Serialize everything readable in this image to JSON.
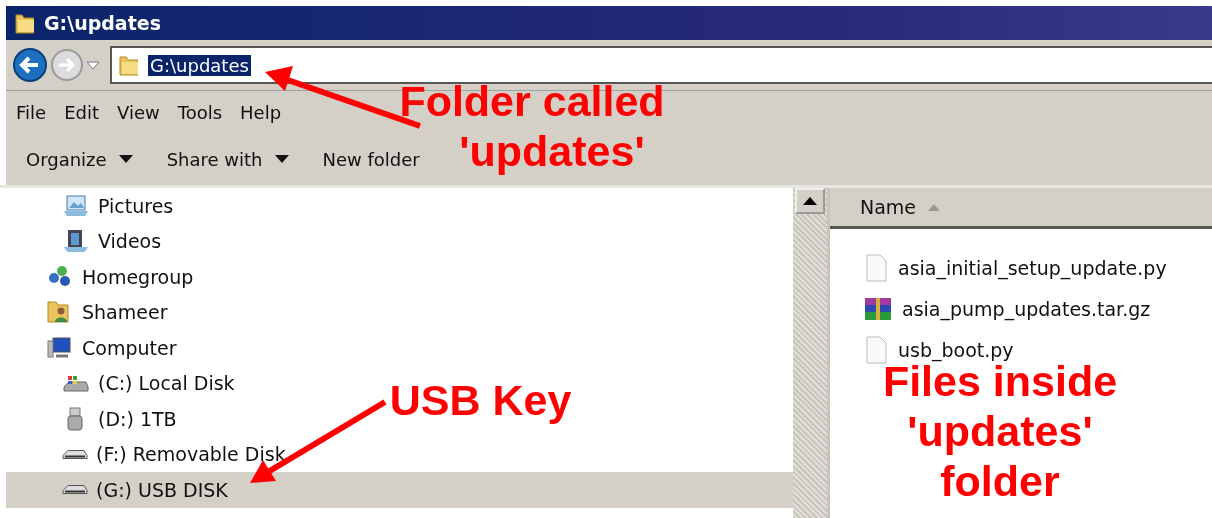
{
  "window": {
    "title": "G:\\updates"
  },
  "address_bar": {
    "path": "G:\\updates",
    "selected": true
  },
  "menu": [
    "File",
    "Edit",
    "View",
    "Tools",
    "Help"
  ],
  "toolbar": [
    {
      "label": "Organize",
      "dropdown": true
    },
    {
      "label": "Share with",
      "dropdown": true
    },
    {
      "label": "New folder",
      "dropdown": false
    }
  ],
  "tree": [
    {
      "children": [
        {
          "label": "Pictures",
          "kind": "pictures",
          "selected": false
        },
        {
          "label": "Videos",
          "kind": "videos",
          "selected": false
        }
      ]
    },
    {
      "label": "Homegroup",
      "kind": "homegroup",
      "selected": false
    },
    {
      "label": "Shameer",
      "kind": "user",
      "selected": false
    },
    {
      "label": "Computer",
      "kind": "computer",
      "selected": false,
      "children": [
        {
          "label": "(C:) Local Disk",
          "kind": "system-disk",
          "selected": false
        },
        {
          "label": "(D:) 1TB",
          "kind": "usb-drive",
          "selected": false
        },
        {
          "label": "(F:) Removable Disk",
          "kind": "removable",
          "selected": false
        },
        {
          "label": "(G:) USB DISK",
          "kind": "removable",
          "selected": true
        }
      ]
    }
  ],
  "file_list": {
    "columns": [
      {
        "label": "Name",
        "sorted_ascending": true
      }
    ],
    "files": [
      {
        "name": "asia_initial_setup_update.py",
        "kind": "document"
      },
      {
        "name": "asia_pump_updates.tar.gz",
        "kind": "archive"
      },
      {
        "name": "usb_boot.py",
        "kind": "document"
      }
    ]
  },
  "annotations": [
    {
      "lines": [
        "Folder called",
        "'updates'"
      ]
    },
    {
      "lines": [
        "USB Key"
      ]
    },
    {
      "lines": [
        "Files inside",
        "'updates'",
        "folder"
      ]
    }
  ]
}
